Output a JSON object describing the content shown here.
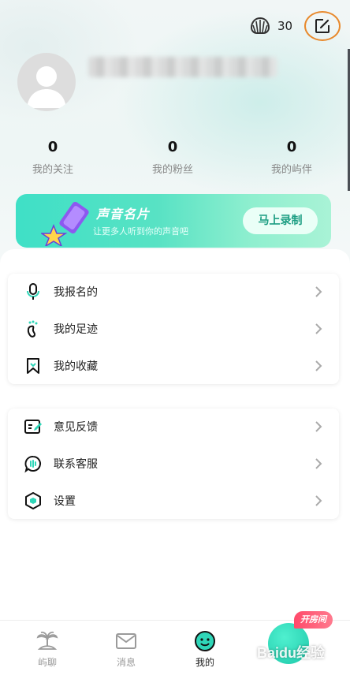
{
  "topbar": {
    "coin_count": "30"
  },
  "profile": {
    "stats": [
      {
        "value": "0",
        "label": "我的关注"
      },
      {
        "value": "0",
        "label": "我的粉丝"
      },
      {
        "value": "0",
        "label": "我的屿伴"
      }
    ]
  },
  "banner": {
    "title": "声音名片",
    "subtitle": "让更多人听到你的声音吧",
    "button": "马上录制"
  },
  "menu_group_1": [
    {
      "label": "我报名的",
      "icon": "microphone-icon"
    },
    {
      "label": "我的足迹",
      "icon": "footprint-icon"
    },
    {
      "label": "我的收藏",
      "icon": "bookmark-icon"
    }
  ],
  "menu_group_2": [
    {
      "label": "意见反馈",
      "icon": "feedback-icon"
    },
    {
      "label": "联系客服",
      "icon": "customer-service-icon"
    },
    {
      "label": "设置",
      "icon": "settings-icon"
    }
  ],
  "tabbar": {
    "tabs": [
      {
        "label": "屿聊",
        "icon": "island-icon"
      },
      {
        "label": "消息",
        "icon": "message-icon"
      },
      {
        "label": "我的",
        "icon": "smile-icon",
        "active": true
      }
    ],
    "fab_badge": "开房间"
  },
  "watermark": "Baidu经验",
  "colors": {
    "accent": "#3fe0c6",
    "edit_highlight": "#e8892c",
    "badge": "#ff4a6a"
  }
}
